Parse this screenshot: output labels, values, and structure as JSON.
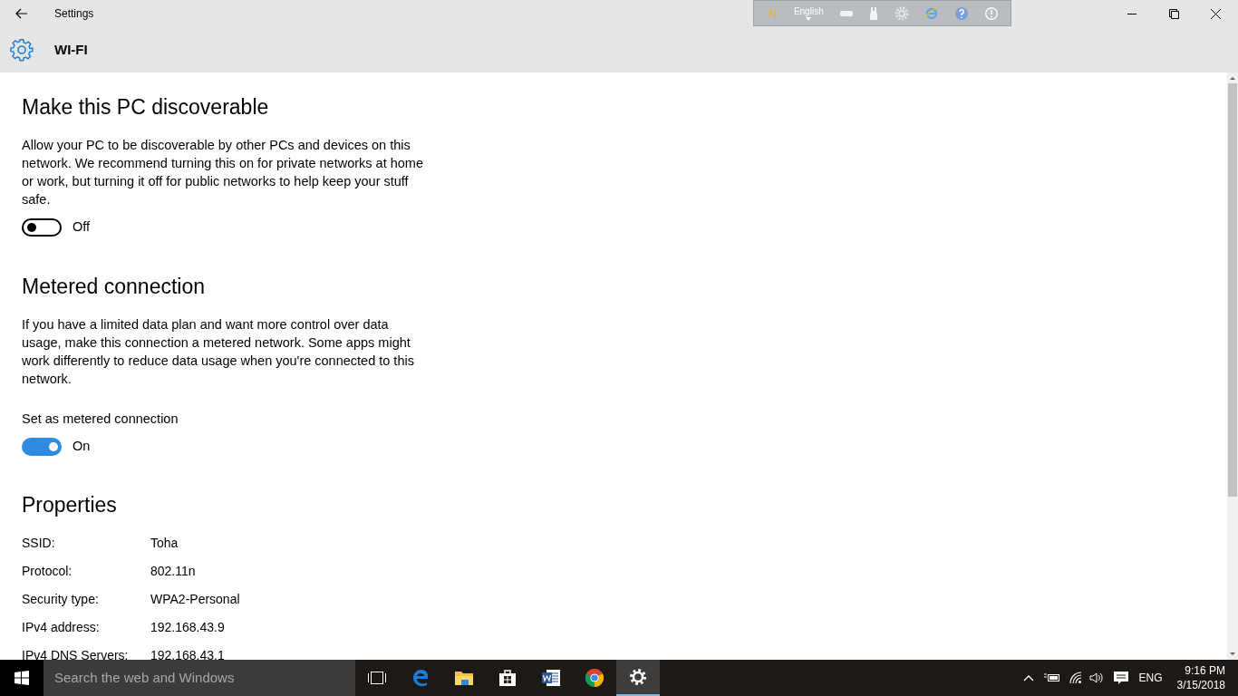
{
  "window": {
    "title": "Settings",
    "page_title": "WI-FI"
  },
  "language_bar": {
    "language": "English"
  },
  "sections": [
    {
      "kind": "toggle",
      "heading": "Make this PC discoverable",
      "description": "Allow your PC to be discoverable by other PCs and devices on this network. We recommend turning this on for private networks at home or work, but turning it off for public networks to help keep your stuff safe.",
      "toggle": {
        "on": false,
        "state_text": "Off"
      }
    },
    {
      "kind": "toggle",
      "heading": "Metered connection",
      "description": "If you have a limited data plan and want more control over data usage, make this connection a metered network. Some apps might work differently to reduce data usage when you're connected to this network.",
      "toggle_label": "Set as metered connection",
      "toggle": {
        "on": true,
        "state_text": "On"
      }
    },
    {
      "kind": "properties",
      "heading": "Properties",
      "rows": [
        {
          "label": "SSID:",
          "value": "Toha"
        },
        {
          "label": "Protocol:",
          "value": "802.11n"
        },
        {
          "label": "Security type:",
          "value": "WPA2-Personal"
        },
        {
          "label": "IPv4 address:",
          "value": "192.168.43.9"
        },
        {
          "label": "IPv4 DNS Servers:",
          "value": "192.168.43.1"
        }
      ]
    }
  ],
  "taskbar": {
    "search_placeholder": "Search the web and Windows",
    "apps": [
      {
        "kind": "task-view",
        "selected": false
      },
      {
        "kind": "edge",
        "selected": false
      },
      {
        "kind": "folder",
        "selected": false
      },
      {
        "kind": "store",
        "selected": false
      },
      {
        "kind": "word",
        "selected": false
      },
      {
        "kind": "chrome",
        "selected": false
      },
      {
        "kind": "settings",
        "selected": true
      }
    ],
    "language": "ENG",
    "time": "9:16 PM",
    "date": "3/15/2018"
  }
}
